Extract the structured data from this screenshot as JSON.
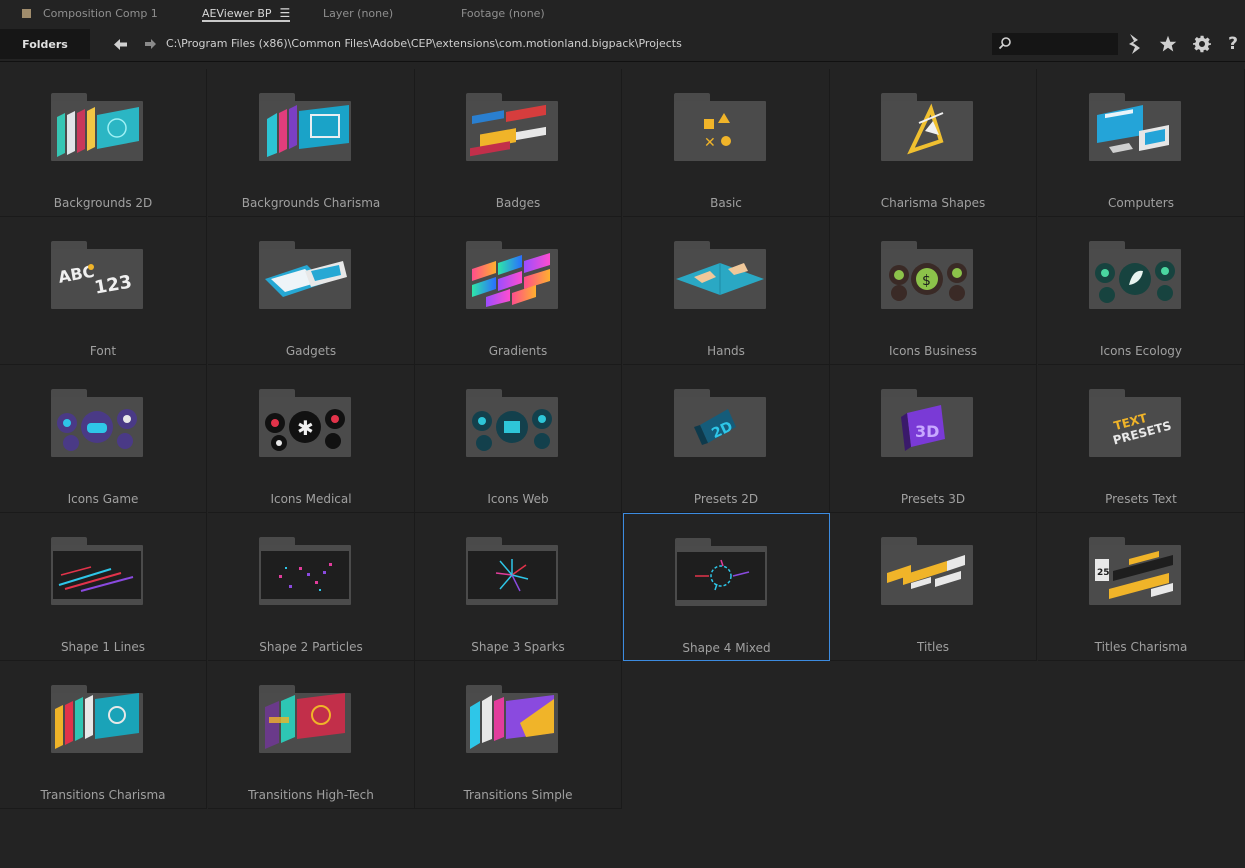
{
  "tabs": [
    {
      "label": "Composition Comp 1"
    },
    {
      "label": "AEViewer BP"
    },
    {
      "label": "Layer (none)"
    },
    {
      "label": "Footage (none)"
    }
  ],
  "toolbar": {
    "folders_label": "Folders",
    "path": "C:\\Program Files (x86)\\Common Files\\Adobe\\CEP\\extensions\\com.motionland.bigpack\\Projects",
    "search_placeholder": "",
    "icons": [
      "back-arrow-icon",
      "forward-arrow-icon",
      "search-icon",
      "lightning-icon",
      "star-icon",
      "gear-icon",
      "help-icon"
    ]
  },
  "folders": [
    {
      "name": "Backgrounds 2D",
      "thumb": "bg2d"
    },
    {
      "name": "Backgrounds Charisma",
      "thumb": "bgchar"
    },
    {
      "name": "Badges",
      "thumb": "badges"
    },
    {
      "name": "Basic",
      "thumb": "basic"
    },
    {
      "name": "Charisma Shapes",
      "thumb": "charshapes"
    },
    {
      "name": "Computers",
      "thumb": "computers"
    },
    {
      "name": "Font",
      "thumb": "font"
    },
    {
      "name": "Gadgets",
      "thumb": "gadgets"
    },
    {
      "name": "Gradients",
      "thumb": "gradients"
    },
    {
      "name": "Hands",
      "thumb": "hands"
    },
    {
      "name": "Icons Business",
      "thumb": "iconsbiz"
    },
    {
      "name": "Icons Ecology",
      "thumb": "iconseco"
    },
    {
      "name": "Icons Game",
      "thumb": "iconsgame"
    },
    {
      "name": "Icons Medical",
      "thumb": "iconsmed"
    },
    {
      "name": "Icons Web",
      "thumb": "iconsweb"
    },
    {
      "name": "Presets 2D",
      "thumb": "presets2d"
    },
    {
      "name": "Presets 3D",
      "thumb": "presets3d"
    },
    {
      "name": "Presets Text",
      "thumb": "presetstext"
    },
    {
      "name": "Shape 1 Lines",
      "thumb": "shape1"
    },
    {
      "name": "Shape 2 Particles",
      "thumb": "shape2"
    },
    {
      "name": "Shape 3 Sparks",
      "thumb": "shape3"
    },
    {
      "name": "Shape 4 Mixed",
      "thumb": "shape4",
      "selected": true
    },
    {
      "name": "Titles",
      "thumb": "titles"
    },
    {
      "name": "Titles Charisma",
      "thumb": "titleschar"
    },
    {
      "name": "Transitions Charisma",
      "thumb": "transchar"
    },
    {
      "name": "Transitions High-Tech",
      "thumb": "transhitech"
    },
    {
      "name": "Transitions Simple",
      "thumb": "transsimple"
    }
  ],
  "colors": {
    "background": "#232323",
    "selected_border": "#3c8be0",
    "folder": "#4b4b4b"
  }
}
